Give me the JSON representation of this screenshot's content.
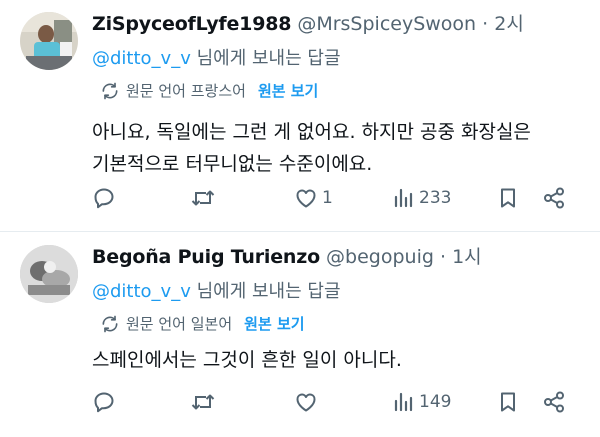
{
  "tweets": [
    {
      "name": "ZiSpyceofLyfe1988",
      "handle": "@MrsSpiceySwoon",
      "dot": "·",
      "time": "2시",
      "reply_to_mention": "@ditto_v_v",
      "reply_to_suffix": " 님에게 보내는 답글",
      "translation_note": "원문 언어 프랑스어",
      "show_original": "원본 보기",
      "body_line1": "아니요, 독일에는 그런 게 없어요. 하지만 공중 화장실은",
      "body_line2": "기본적으로 터무니없는 수준이에요.",
      "replies": "",
      "retweets": "",
      "likes": "1",
      "views": "233"
    },
    {
      "name": "Begoña Puig Turienzo",
      "handle": "@begopuig",
      "dot": "·",
      "time": "1시",
      "reply_to_mention": "@ditto_v_v",
      "reply_to_suffix": " 님에게 보내는 답글",
      "translation_note": "원문 언어 일본어",
      "show_original": "원본 보기",
      "body_line1": "스페인에서는 그것이 흔한 일이 아니다.",
      "replies": "",
      "retweets": "",
      "likes": "",
      "views": "149"
    }
  ],
  "icons": {
    "reply": "reply-icon",
    "retweet": "retweet-icon",
    "like": "heart-icon",
    "views": "views-icon",
    "bookmark": "bookmark-icon",
    "share": "share-icon",
    "translate": "translate-icon"
  },
  "colors": {
    "link": "#1d9bf0",
    "secondary": "#536471",
    "text": "#0f1419",
    "divider": "#e6ecf0"
  }
}
